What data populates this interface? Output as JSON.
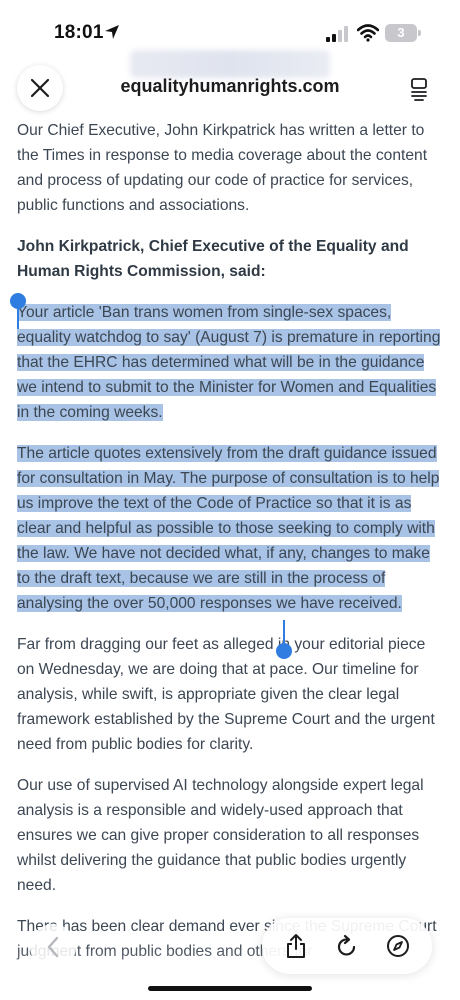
{
  "status_bar": {
    "time": "18:01",
    "battery": "3",
    "location_icon": "location-arrow-icon",
    "signal_icon": "cellular-signal-icon",
    "wifi_icon": "wifi-icon"
  },
  "nav": {
    "domain": "equalityhumanrights.com",
    "close_icon": "close-icon",
    "reader_icon": "reader-mode-icon"
  },
  "article": {
    "intro": "Our Chief Executive, John Kirkpatrick has written a letter to the Times in response to media coverage about the content and process of updating our code of practice for services, public functions and associations.",
    "byline": "John Kirkpatrick, Chief Executive of the Equality and Human Rights Commission, said:",
    "para1": "Your article 'Ban trans women from single-sex spaces, equality watchdog to say' (August 7) is premature in reporting that the EHRC has determined what will be in the guidance we intend to submit to the Minister for Women and Equalities in the coming weeks.",
    "para2": "The article quotes extensively from the draft guidance issued for consultation in May. The purpose of consultation is to help us improve the text of the Code of Practice so that it is as clear and helpful as possible to those seeking to comply with the law. We have not decided what, if any, changes to make to the draft text, because we are still in the process of analysing the over 50,000 responses we have received.",
    "para3": "Far from dragging our feet as alleged in your editorial piece on Wednesday, we are doing that at pace. Our timeline for analysis, while swift, is appropriate given the clear legal framework established by the Supreme Court and the urgent need from public bodies for clarity.",
    "para4": "Our use of supervised AI technology alongside expert legal analysis is a responsible and widely-used approach that ensures we can give proper consideration to all responses whilst delivering the guidance that public bodies urgently need.",
    "para5": "There has been clear demand ever since the Supreme Court judgment from public bodies and others for"
  },
  "toolbar": {
    "back_icon": "chevron-left-icon",
    "share_icon": "share-icon",
    "reload_icon": "reload-icon",
    "compass_icon": "compass-icon"
  },
  "colors": {
    "selection": "#a8c3e6",
    "selection_handle": "#2f7de0",
    "text": "#3c4753"
  }
}
